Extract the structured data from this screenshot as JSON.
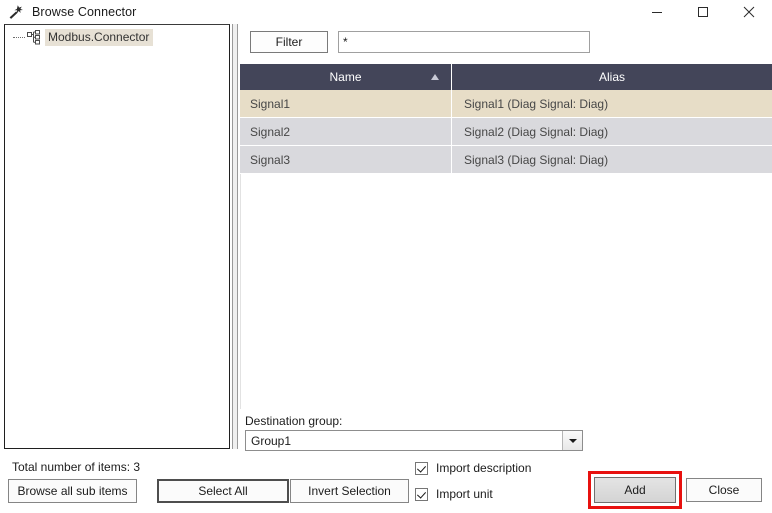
{
  "window": {
    "title": "Browse Connector",
    "icon": "connector-plug-icon",
    "minimize_label": "—",
    "maximize_label": "□",
    "close_label": "✕"
  },
  "tree": {
    "nodes": [
      {
        "label": "Modbus.Connector",
        "icon": "hierarchy-node-icon",
        "selected": true
      }
    ]
  },
  "filter": {
    "button_label": "Filter",
    "input_value": "*",
    "input_placeholder": ""
  },
  "grid": {
    "columns": [
      {
        "label": "Name",
        "sort": "ascending"
      },
      {
        "label": "Alias",
        "sort": "none"
      }
    ],
    "rows": [
      {
        "name": "Signal1",
        "alias": "Signal1 (Diag Signal: Diag)",
        "selected": true
      },
      {
        "name": "Signal2",
        "alias": "Signal2 (Diag Signal: Diag)",
        "selected": false
      },
      {
        "name": "Signal3",
        "alias": "Signal3 (Diag Signal: Diag)",
        "selected": false
      }
    ]
  },
  "destination": {
    "label": "Destination group:",
    "selected": "Group1"
  },
  "status": {
    "total_items": "Total number of items: 3"
  },
  "options": {
    "import_description": {
      "label": "Import description",
      "checked": true
    },
    "import_unit": {
      "label": "Import unit",
      "checked": true
    }
  },
  "buttons": {
    "browse_sub_items": "Browse all sub items",
    "select_all": "Select All",
    "invert_selection": "Invert Selection",
    "add": "Add",
    "close": "Close"
  },
  "colors": {
    "header_bg": "#434559",
    "row_selected": "#e7ddc7",
    "row_alt": "#d9d9dd",
    "tree_selected": "#e7e1d5",
    "annotation": "#e8110f"
  }
}
